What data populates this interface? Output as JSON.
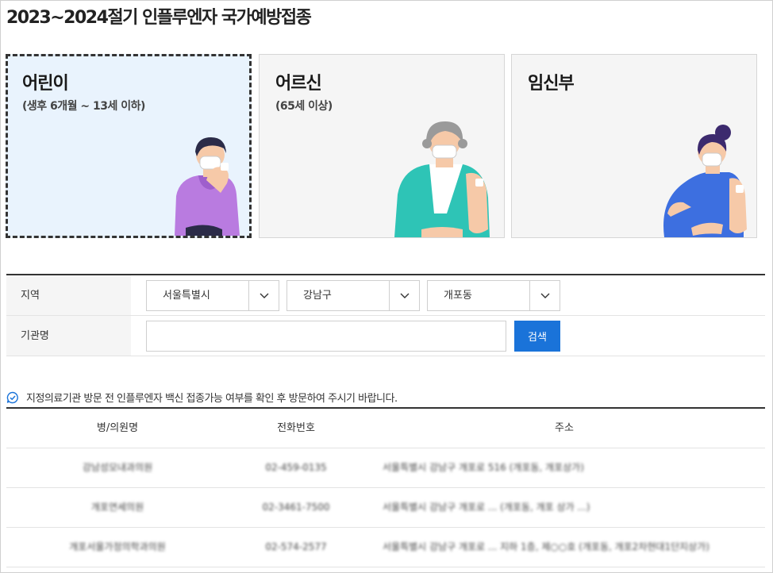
{
  "page": {
    "title": "2023~2024절기 인플루엔자 국가예방접종"
  },
  "cards": [
    {
      "title": "어린이",
      "subtitle": "(생후 6개월 ~ 13세 이하)",
      "selected": true
    },
    {
      "title": "어르신",
      "subtitle": "(65세 이상)",
      "selected": false
    },
    {
      "title": "임신부",
      "subtitle": "",
      "selected": false
    }
  ],
  "filter": {
    "region_label": "지역",
    "region_values": [
      "서울특별시",
      "강남구",
      "개포동"
    ],
    "institution_label": "기관명",
    "institution_value": "",
    "institution_placeholder": "",
    "search_label": "검색"
  },
  "notice": {
    "text": "지정의료기관 방문 전 인플루엔자 백신 접종가능 여부를 확인 후 방문하여 주시기 바랍니다."
  },
  "table": {
    "headers": [
      "병/의원명",
      "전화번호",
      "주소"
    ],
    "rows": [
      {
        "name": "강남성모내과의원",
        "phone": "02-459-0135",
        "address": "서울특별시 강남구 개포로 516 (개포동, 개포상가)"
      },
      {
        "name": "개포연세의원",
        "phone": "02-3461-7500",
        "address": "서울특별시 강남구 개포로 ... (개포동, 개포 상가 ...)"
      },
      {
        "name": "개포서울가정의학과의원",
        "phone": "02-574-2577",
        "address": "서울특별시 강남구 개포로 ... 지하 1층, 제○○호 (개포동, 개포2차현대1단지상가)"
      }
    ]
  },
  "colors": {
    "accent": "#1a73d9",
    "selected_card_bg": "#e9f3fd",
    "card_bg": "#f5f5f5"
  }
}
